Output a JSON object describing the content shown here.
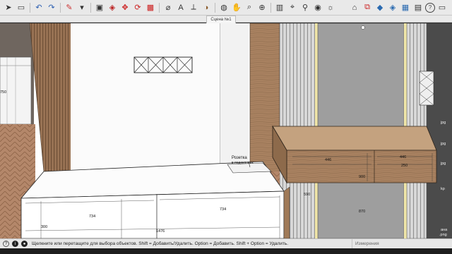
{
  "scene": {
    "tab_label": "Сцена №1"
  },
  "toolbar": {
    "left_icons": [
      "select-icon",
      "eraser-icon",
      "undo-icon",
      "redo-icon",
      "pencil-icon",
      "shape-icon",
      "push-pull-icon",
      "move-icon",
      "rotate-icon",
      "scale-icon",
      "offset-icon",
      "tape-icon",
      "text-icon",
      "axes-icon",
      "paint-icon",
      "orbit-icon",
      "pan-icon",
      "zoom-icon",
      "zoom-extents-icon",
      "section-icon",
      "camera-icon",
      "walk-icon",
      "look-icon",
      "shadow-icon",
      "fog-icon"
    ],
    "right_icons": [
      "home-icon",
      "layers-icon",
      "components-icon",
      "materials-icon",
      "styles-icon",
      "scenes-icon",
      "ruby-icon",
      "extensions-icon"
    ],
    "account_label": "?"
  },
  "viewport": {
    "tags": {
      "outlet_label": "Розетка",
      "outlet_sub": "в подоконник"
    },
    "dimensions": {
      "lower_left_width": "734",
      "lower_right_width": "734",
      "lower_total": "1476",
      "lower_height": "300",
      "upper_left_width": "446",
      "upper_right_width": "446",
      "upper_height": "250",
      "upper_depth": "900",
      "gap_left": "590",
      "gap_right": "870",
      "far_left": "750"
    },
    "side_labels": {
      "right_top": "jpg",
      "right_mid1": "jpg",
      "right_mid2": "jpg",
      "right_mid3": "kp",
      "right_bottom": "ана",
      "right_bottom2": ".png"
    }
  },
  "statusbar": {
    "hint": "Щелкните или перетащите для выбора объектов. Shift = Добавить/Удалить. Option = Добавить. Shift + Option = Удалить.",
    "measure_label": "Измерения"
  },
  "colors": {
    "wood": "#a07a58",
    "wall_panel": "#b9b9b9",
    "floor": "#b08567",
    "cabinet": "#ffffff",
    "accent_light": "#f0e6a8"
  }
}
